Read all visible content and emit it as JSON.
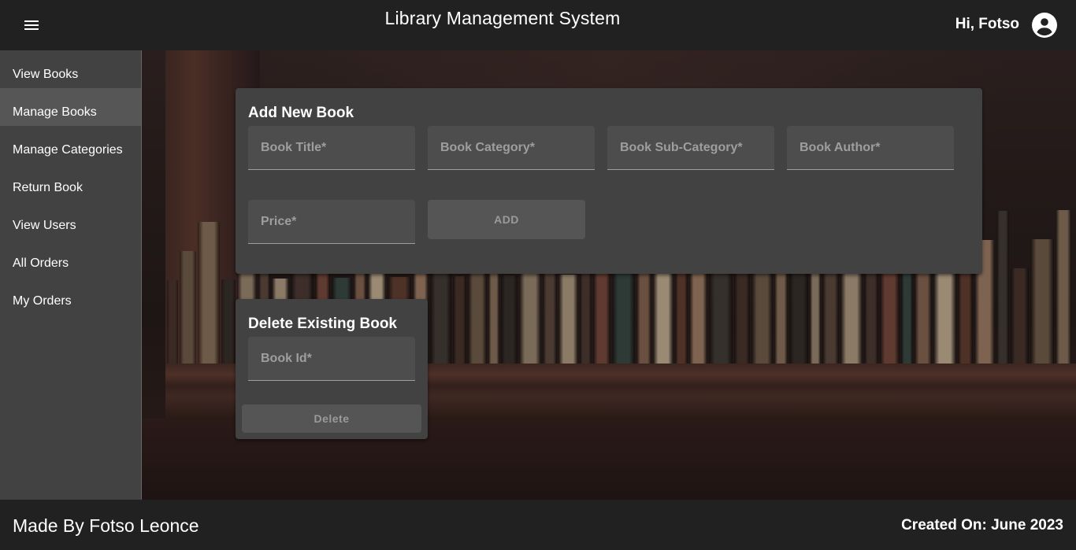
{
  "header": {
    "title": "Library Management System",
    "greeting": "Hi, Fotso",
    "menu_icon": "hamburger-menu-icon",
    "avatar_icon": "account-circle-icon"
  },
  "sidebar": {
    "items": [
      {
        "label": "View Books",
        "active": false
      },
      {
        "label": "Manage Books",
        "active": true
      },
      {
        "label": "Manage Categories",
        "active": false
      },
      {
        "label": "Return Book",
        "active": false
      },
      {
        "label": "View Users",
        "active": false
      },
      {
        "label": "All Orders",
        "active": false
      },
      {
        "label": "My Orders",
        "active": false
      }
    ]
  },
  "add_book": {
    "title": "Add New Book",
    "fields": {
      "book_title": {
        "label": "Book Title*",
        "value": ""
      },
      "book_category": {
        "label": "Book Category*",
        "value": ""
      },
      "book_sub_category": {
        "label": "Book Sub-Category*",
        "value": ""
      },
      "book_author": {
        "label": "Book Author*",
        "value": ""
      },
      "price": {
        "label": "Price*",
        "value": ""
      }
    },
    "button_label": "ADD"
  },
  "delete_book": {
    "title": "Delete Existing Book",
    "fields": {
      "book_id": {
        "label": "Book Id*",
        "value": ""
      }
    },
    "button_label": "Delete"
  },
  "footer": {
    "left": "Made By Fotso Leonce",
    "right": "Created On: June 2023"
  },
  "colors": {
    "header_bg": "#212121",
    "sidebar_bg": "#424242",
    "card_bg": "#424242",
    "field_bg": "#4d4d4d",
    "button_bg": "#555555"
  }
}
